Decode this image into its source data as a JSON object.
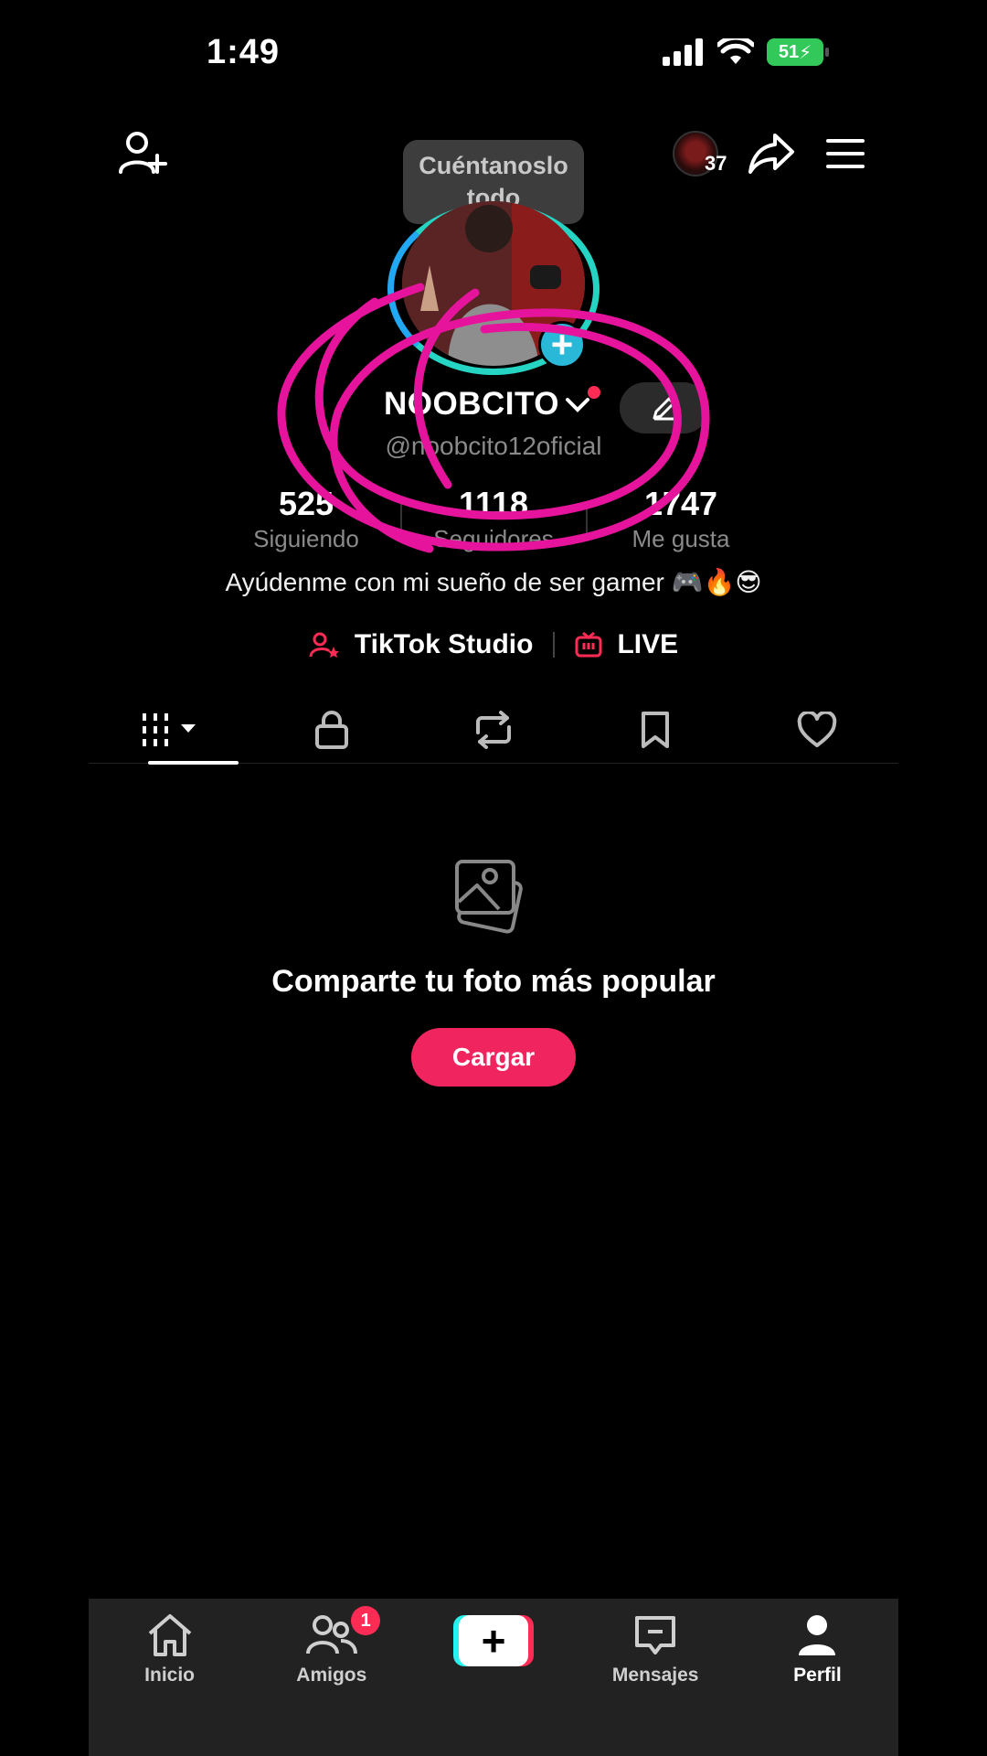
{
  "status_bar": {
    "time": "1:49",
    "battery": "51"
  },
  "header": {
    "tooltip": "Cuéntanoslo todo",
    "viewer_count": "37"
  },
  "profile": {
    "username": "NOOBCITO",
    "handle": "@noobcito12oficial",
    "stats": [
      {
        "value": "525",
        "label": "Siguiendo"
      },
      {
        "value": "1118",
        "label": "Seguidores"
      },
      {
        "value": "1747",
        "label": "Me gusta"
      }
    ],
    "bio": "Ayúdenme con mi sueño de ser gamer 🎮🔥😎",
    "links": {
      "studio": "TikTok Studio",
      "live": "LIVE"
    }
  },
  "tabs": [
    "videos-tab",
    "private-tab",
    "reposts-tab",
    "saved-tab",
    "liked-tab"
  ],
  "empty_state": {
    "title": "Comparte tu foto más popular",
    "button": "Cargar"
  },
  "bottom_nav": {
    "items": [
      {
        "label": "Inicio"
      },
      {
        "label": "Amigos",
        "badge": "1"
      },
      {
        "label": ""
      },
      {
        "label": "Mensajes"
      },
      {
        "label": "Perfil"
      }
    ]
  },
  "colors": {
    "accent": "#fe2c55",
    "cta": "#f0245e",
    "annotation": "#e6139c",
    "ring": "#25d4c3"
  }
}
